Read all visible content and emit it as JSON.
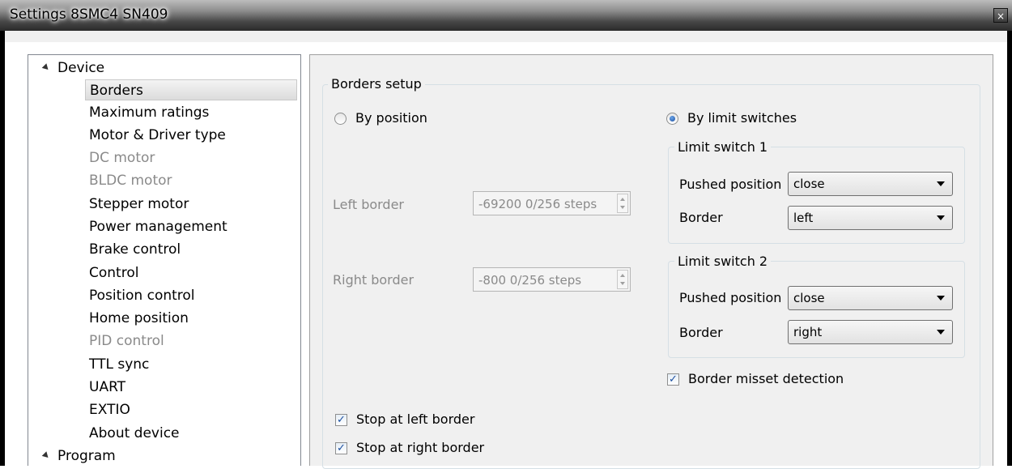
{
  "window": {
    "title": "Settings 8SMC4 SN409",
    "close_glyph": "×"
  },
  "tree": {
    "device": {
      "label": "Device",
      "children": [
        {
          "label": "Borders",
          "selected": true,
          "enabled": true
        },
        {
          "label": "Maximum ratings",
          "enabled": true
        },
        {
          "label": "Motor & Driver type",
          "enabled": true
        },
        {
          "label": "DC motor",
          "enabled": false
        },
        {
          "label": "BLDC motor",
          "enabled": false
        },
        {
          "label": "Stepper motor",
          "enabled": true
        },
        {
          "label": "Power management",
          "enabled": true
        },
        {
          "label": "Brake control",
          "enabled": true
        },
        {
          "label": "Control",
          "enabled": true
        },
        {
          "label": "Position control",
          "enabled": true
        },
        {
          "label": "Home position",
          "enabled": true
        },
        {
          "label": "PID control",
          "enabled": false
        },
        {
          "label": "TTL sync",
          "enabled": true
        },
        {
          "label": "UART",
          "enabled": true
        },
        {
          "label": "EXTIO",
          "enabled": true
        },
        {
          "label": "About device",
          "enabled": true
        }
      ]
    },
    "program": {
      "label": "Program"
    }
  },
  "borders": {
    "group_title": "Borders setup",
    "by_position": {
      "label": "By position",
      "checked": false
    },
    "by_limit_switches": {
      "label": "By limit switches",
      "checked": true
    },
    "left_border": {
      "label": "Left border",
      "value": "-69200 0/256 steps"
    },
    "right_border": {
      "label": "Right border",
      "value": "-800 0/256 steps"
    },
    "limit_switch_1": {
      "title": "Limit switch 1",
      "pushed_position": {
        "label": "Pushed position",
        "value": "close"
      },
      "border": {
        "label": "Border",
        "value": "left"
      }
    },
    "limit_switch_2": {
      "title": "Limit switch 2",
      "pushed_position": {
        "label": "Pushed position",
        "value": "close"
      },
      "border": {
        "label": "Border",
        "value": "right"
      }
    },
    "border_misset_detection": {
      "label": "Border misset detection",
      "checked": true
    },
    "stop_at_left_border": {
      "label": "Stop at left border",
      "checked": true
    },
    "stop_at_right_border": {
      "label": "Stop at right border",
      "checked": true
    }
  },
  "icons": {
    "expander": "triangle-down",
    "checkmark": "✓",
    "radio_dot": "filled-circle"
  }
}
